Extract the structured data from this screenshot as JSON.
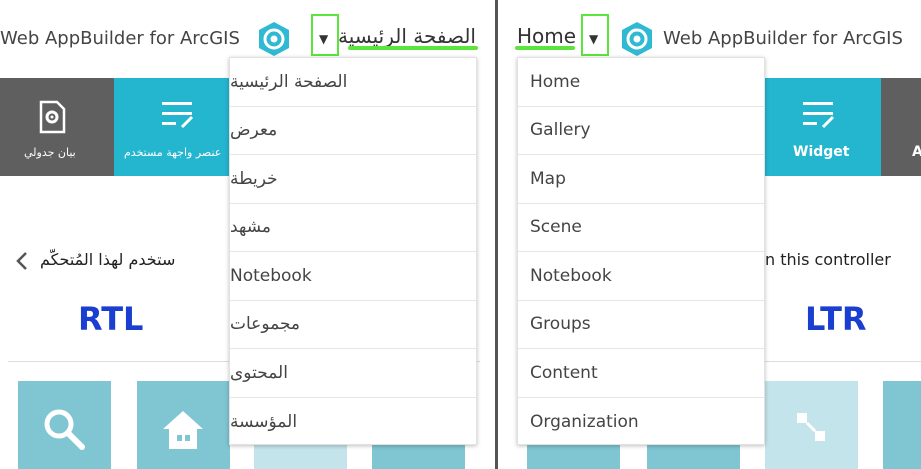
{
  "left": {
    "app_title": "Web AppBuilder for ArcGIS",
    "home_link": "الصفحة الرئيسية",
    "tiles": {
      "table": "بيان جدولي",
      "widget": "عنصر واجهة مستخدم"
    },
    "hint": "ستخدم لهذا المُتحكّم",
    "direction_label": "RTL",
    "menu": [
      "الصفحة الرئيسية",
      "معرض",
      "خريطة",
      "مشهد",
      "Notebook",
      "مجموعات",
      "المحتوى",
      "المؤسسة"
    ]
  },
  "right": {
    "app_title": "Web AppBuilder for ArcGIS",
    "home_link": "Home",
    "tiles": {
      "widget": "Widget",
      "partial": "A"
    },
    "hint": "n this controller",
    "direction_label": "LTR",
    "menu": [
      "Home",
      "Gallery",
      "Map",
      "Scene",
      "Notebook",
      "Groups",
      "Content",
      "Organization"
    ]
  },
  "colors": {
    "teal": "#24b5cf",
    "dark": "#5f5f5f",
    "highlight": "#5ce63c",
    "light_tile": "#7fc5d2",
    "pale_tile": "#c3e4ea"
  },
  "icons": [
    "gear-document-icon",
    "widget-icon",
    "chevron-down-icon",
    "chevron-left-icon",
    "search-icon",
    "home-icon",
    "arcgis-logo-icon"
  ]
}
